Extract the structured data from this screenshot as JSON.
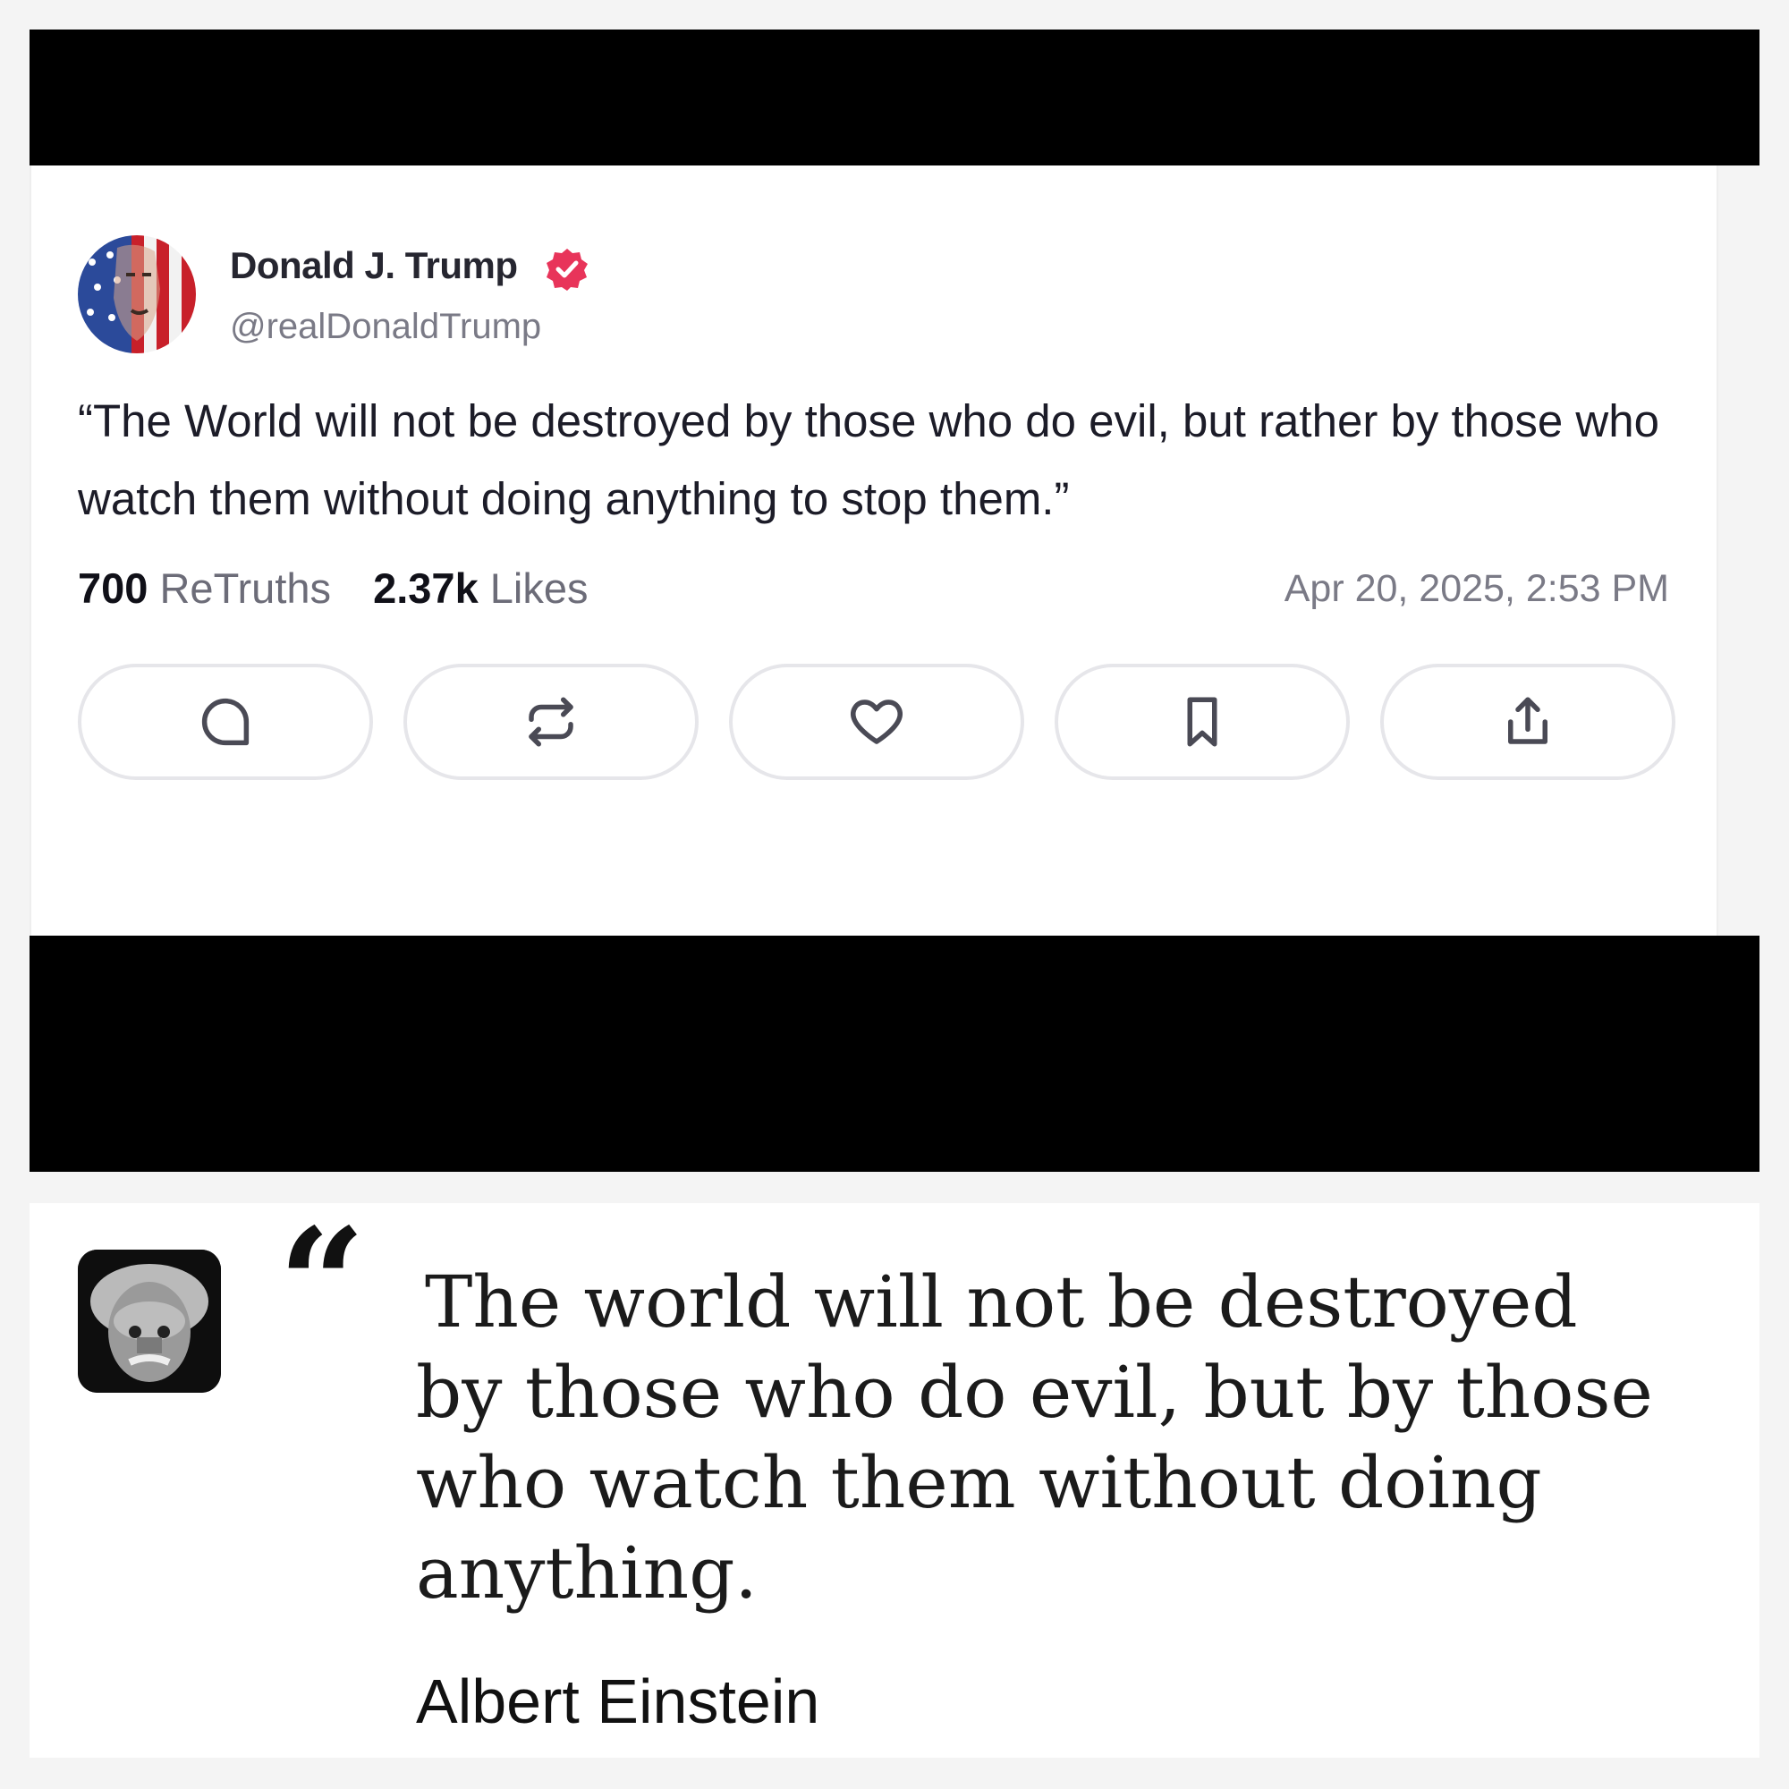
{
  "post": {
    "author_name": "Donald J. Trump",
    "author_handle": "@realDonaldTrump",
    "verified": true,
    "text": "“The World will not be destroyed by those who do evil, but rather by those who watch them without doing anything to stop them.”",
    "retruths_count": "700",
    "retruths_label": "ReTruths",
    "likes_count": "2.37k",
    "likes_label": "Likes",
    "timestamp": "Apr 20, 2025, 2:53 PM",
    "actions": [
      {
        "name": "reply",
        "icon": "comment-icon"
      },
      {
        "name": "retruth",
        "icon": "repost-icon"
      },
      {
        "name": "like",
        "icon": "heart-icon"
      },
      {
        "name": "bookmark",
        "icon": "bookmark-icon"
      },
      {
        "name": "share",
        "icon": "share-icon"
      }
    ]
  },
  "quote": {
    "mark": "“",
    "text": "The world will not be destroyed by those who do evil, but by those who watch them without doing anything.",
    "author": "Albert Einstein"
  },
  "colors": {
    "verified_badge": "#e8345a",
    "redaction_bar": "#000000",
    "action_border": "#e6e6ea"
  }
}
